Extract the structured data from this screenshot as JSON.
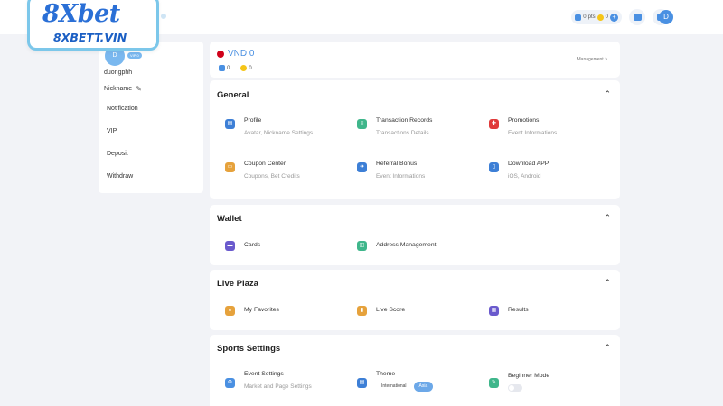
{
  "brand": {
    "logo_text": "8Xbet",
    "logo_subtext": "8XBETT.VIN"
  },
  "header": {
    "balance_pill_1": "0",
    "balance_pill_1_unit": "pts",
    "balance_pill_2": "0",
    "avatar_letter": "D"
  },
  "sidebar": {
    "avatar_letter": "D",
    "vip_badge": "VIP 0",
    "username": "duongphh",
    "nickname_label": "Nickname",
    "items": [
      {
        "label": "Notification"
      },
      {
        "label": "VIP"
      },
      {
        "label": "Deposit"
      },
      {
        "label": "Withdraw"
      }
    ]
  },
  "balance": {
    "currency_amount": "VND 0",
    "stat_1": "0",
    "stat_2": "0",
    "management_link": "Management >"
  },
  "sections": {
    "general": {
      "title": "General",
      "items": [
        {
          "title": "Profile",
          "subtitle": "Avatar, Nickname Settings",
          "icon": "profile-icon",
          "color": "#3d7fd6"
        },
        {
          "title": "Transaction Records",
          "subtitle": "Transactions Details",
          "icon": "records-icon",
          "color": "#3fb68b"
        },
        {
          "title": "Promotions",
          "subtitle": "Event Informations",
          "icon": "gift-icon",
          "color": "#e03a3a"
        },
        {
          "title": "Coupon Center",
          "subtitle": "Coupons, Bet Credits",
          "icon": "coupon-icon",
          "color": "#e6a23c"
        },
        {
          "title": "Referral Bonus",
          "subtitle": "Event Informations",
          "icon": "share-icon",
          "color": "#3d7fd6"
        },
        {
          "title": "Download APP",
          "subtitle": "iOS, Android",
          "icon": "phone-icon",
          "color": "#3d7fd6"
        }
      ]
    },
    "wallet": {
      "title": "Wallet",
      "items": [
        {
          "title": "Cards",
          "icon": "card-icon",
          "color": "#6a5acd"
        },
        {
          "title": "Address Management",
          "icon": "address-icon",
          "color": "#3fb68b"
        }
      ]
    },
    "live_plaza": {
      "title": "Live Plaza",
      "items": [
        {
          "title": "My Favorites",
          "icon": "star-icon",
          "color": "#e6a23c"
        },
        {
          "title": "Live Score",
          "icon": "chart-icon",
          "color": "#e6a23c"
        },
        {
          "title": "Results",
          "icon": "results-icon",
          "color": "#6a5acd"
        }
      ]
    },
    "sports": {
      "title": "Sports Settings",
      "event_settings": {
        "title": "Event Settings",
        "subtitle": "Market and Page Settings",
        "icon": "settings-icon",
        "color": "#4a90e2"
      },
      "theme": {
        "title": "Theme",
        "option_1": "International",
        "option_2": "Asia",
        "selected": "Asia",
        "icon": "theme-icon",
        "color": "#3d7fd6"
      },
      "beginner": {
        "title": "Beginner Mode",
        "enabled": false,
        "icon": "beginner-icon",
        "color": "#3fb68b"
      }
    }
  }
}
